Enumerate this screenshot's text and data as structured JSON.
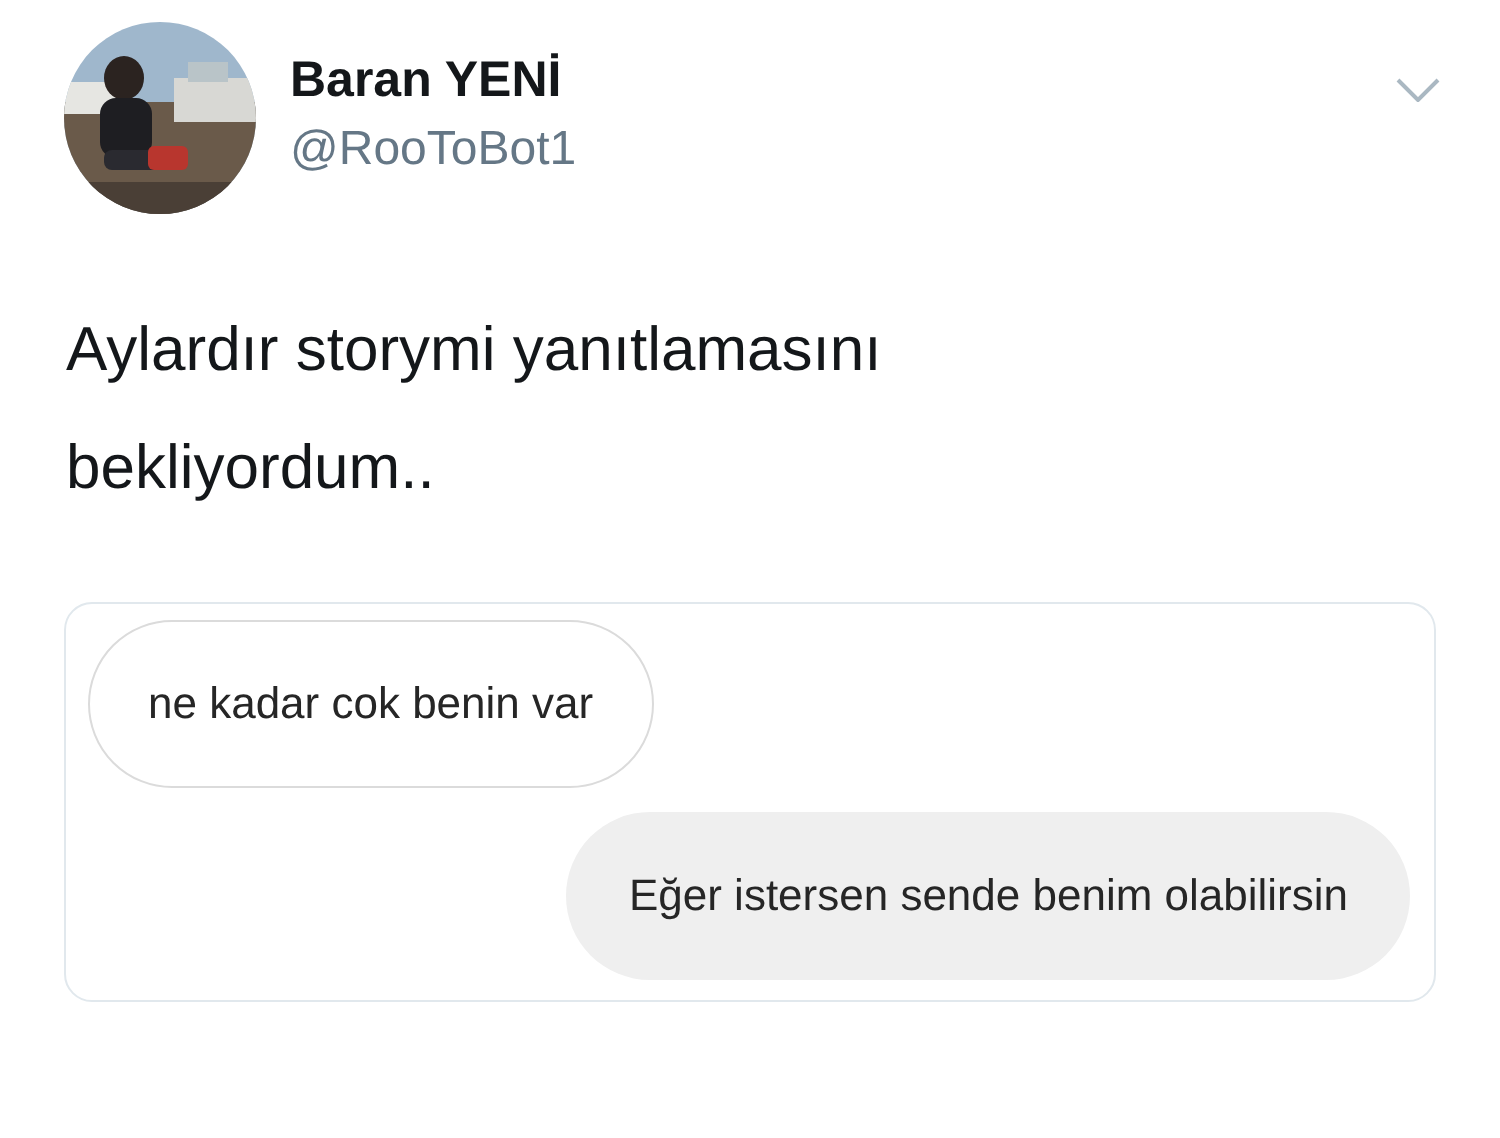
{
  "tweet": {
    "author": {
      "name": "Baran YENİ",
      "handle": "@RooToBot1"
    },
    "text": "Aylardır storymi yanıtlamasını bekliyordum..",
    "attachment": {
      "messages": [
        {
          "kind": "received",
          "text": "ne kadar cok benin var"
        },
        {
          "kind": "sent",
          "text": "Eğer istersen sende benim olabilirsin"
        }
      ]
    }
  }
}
